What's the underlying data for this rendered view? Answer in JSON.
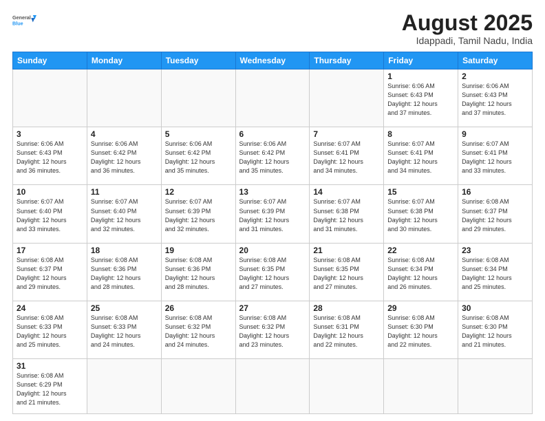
{
  "header": {
    "logo_general": "General",
    "logo_blue": "Blue",
    "title": "August 2025",
    "subtitle": "Idappadi, Tamil Nadu, India"
  },
  "days_of_week": [
    "Sunday",
    "Monday",
    "Tuesday",
    "Wednesday",
    "Thursday",
    "Friday",
    "Saturday"
  ],
  "weeks": [
    [
      {
        "num": "",
        "info": ""
      },
      {
        "num": "",
        "info": ""
      },
      {
        "num": "",
        "info": ""
      },
      {
        "num": "",
        "info": ""
      },
      {
        "num": "",
        "info": ""
      },
      {
        "num": "1",
        "info": "Sunrise: 6:06 AM\nSunset: 6:43 PM\nDaylight: 12 hours\nand 37 minutes."
      },
      {
        "num": "2",
        "info": "Sunrise: 6:06 AM\nSunset: 6:43 PM\nDaylight: 12 hours\nand 37 minutes."
      }
    ],
    [
      {
        "num": "3",
        "info": "Sunrise: 6:06 AM\nSunset: 6:43 PM\nDaylight: 12 hours\nand 36 minutes."
      },
      {
        "num": "4",
        "info": "Sunrise: 6:06 AM\nSunset: 6:42 PM\nDaylight: 12 hours\nand 36 minutes."
      },
      {
        "num": "5",
        "info": "Sunrise: 6:06 AM\nSunset: 6:42 PM\nDaylight: 12 hours\nand 35 minutes."
      },
      {
        "num": "6",
        "info": "Sunrise: 6:06 AM\nSunset: 6:42 PM\nDaylight: 12 hours\nand 35 minutes."
      },
      {
        "num": "7",
        "info": "Sunrise: 6:07 AM\nSunset: 6:41 PM\nDaylight: 12 hours\nand 34 minutes."
      },
      {
        "num": "8",
        "info": "Sunrise: 6:07 AM\nSunset: 6:41 PM\nDaylight: 12 hours\nand 34 minutes."
      },
      {
        "num": "9",
        "info": "Sunrise: 6:07 AM\nSunset: 6:41 PM\nDaylight: 12 hours\nand 33 minutes."
      }
    ],
    [
      {
        "num": "10",
        "info": "Sunrise: 6:07 AM\nSunset: 6:40 PM\nDaylight: 12 hours\nand 33 minutes."
      },
      {
        "num": "11",
        "info": "Sunrise: 6:07 AM\nSunset: 6:40 PM\nDaylight: 12 hours\nand 32 minutes."
      },
      {
        "num": "12",
        "info": "Sunrise: 6:07 AM\nSunset: 6:39 PM\nDaylight: 12 hours\nand 32 minutes."
      },
      {
        "num": "13",
        "info": "Sunrise: 6:07 AM\nSunset: 6:39 PM\nDaylight: 12 hours\nand 31 minutes."
      },
      {
        "num": "14",
        "info": "Sunrise: 6:07 AM\nSunset: 6:38 PM\nDaylight: 12 hours\nand 31 minutes."
      },
      {
        "num": "15",
        "info": "Sunrise: 6:07 AM\nSunset: 6:38 PM\nDaylight: 12 hours\nand 30 minutes."
      },
      {
        "num": "16",
        "info": "Sunrise: 6:08 AM\nSunset: 6:37 PM\nDaylight: 12 hours\nand 29 minutes."
      }
    ],
    [
      {
        "num": "17",
        "info": "Sunrise: 6:08 AM\nSunset: 6:37 PM\nDaylight: 12 hours\nand 29 minutes."
      },
      {
        "num": "18",
        "info": "Sunrise: 6:08 AM\nSunset: 6:36 PM\nDaylight: 12 hours\nand 28 minutes."
      },
      {
        "num": "19",
        "info": "Sunrise: 6:08 AM\nSunset: 6:36 PM\nDaylight: 12 hours\nand 28 minutes."
      },
      {
        "num": "20",
        "info": "Sunrise: 6:08 AM\nSunset: 6:35 PM\nDaylight: 12 hours\nand 27 minutes."
      },
      {
        "num": "21",
        "info": "Sunrise: 6:08 AM\nSunset: 6:35 PM\nDaylight: 12 hours\nand 27 minutes."
      },
      {
        "num": "22",
        "info": "Sunrise: 6:08 AM\nSunset: 6:34 PM\nDaylight: 12 hours\nand 26 minutes."
      },
      {
        "num": "23",
        "info": "Sunrise: 6:08 AM\nSunset: 6:34 PM\nDaylight: 12 hours\nand 25 minutes."
      }
    ],
    [
      {
        "num": "24",
        "info": "Sunrise: 6:08 AM\nSunset: 6:33 PM\nDaylight: 12 hours\nand 25 minutes."
      },
      {
        "num": "25",
        "info": "Sunrise: 6:08 AM\nSunset: 6:33 PM\nDaylight: 12 hours\nand 24 minutes."
      },
      {
        "num": "26",
        "info": "Sunrise: 6:08 AM\nSunset: 6:32 PM\nDaylight: 12 hours\nand 24 minutes."
      },
      {
        "num": "27",
        "info": "Sunrise: 6:08 AM\nSunset: 6:32 PM\nDaylight: 12 hours\nand 23 minutes."
      },
      {
        "num": "28",
        "info": "Sunrise: 6:08 AM\nSunset: 6:31 PM\nDaylight: 12 hours\nand 22 minutes."
      },
      {
        "num": "29",
        "info": "Sunrise: 6:08 AM\nSunset: 6:30 PM\nDaylight: 12 hours\nand 22 minutes."
      },
      {
        "num": "30",
        "info": "Sunrise: 6:08 AM\nSunset: 6:30 PM\nDaylight: 12 hours\nand 21 minutes."
      }
    ],
    [
      {
        "num": "31",
        "info": "Sunrise: 6:08 AM\nSunset: 6:29 PM\nDaylight: 12 hours\nand 21 minutes."
      },
      {
        "num": "",
        "info": ""
      },
      {
        "num": "",
        "info": ""
      },
      {
        "num": "",
        "info": ""
      },
      {
        "num": "",
        "info": ""
      },
      {
        "num": "",
        "info": ""
      },
      {
        "num": "",
        "info": ""
      }
    ]
  ]
}
